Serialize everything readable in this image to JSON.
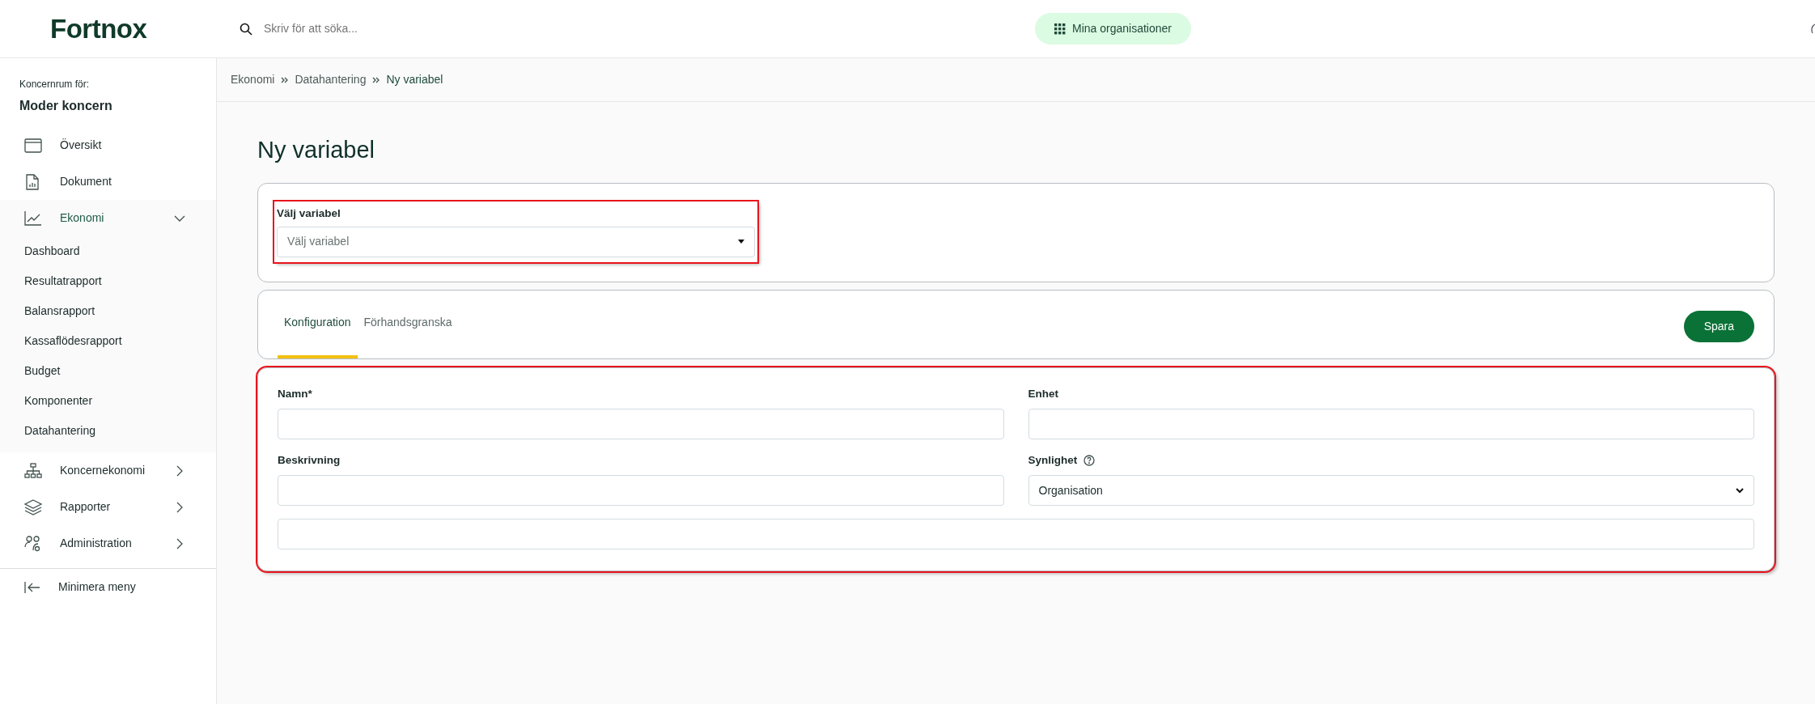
{
  "header": {
    "logo": "Fortnox",
    "search": {
      "placeholder": "Skriv för att söka..."
    },
    "org_button": "Mina organisationer"
  },
  "sidebar": {
    "caption": "Koncernrum för:",
    "org": "Moder koncern",
    "items": [
      {
        "label": "Översikt",
        "kind": "link"
      },
      {
        "label": "Dokument",
        "kind": "link"
      },
      {
        "label": "Ekonomi",
        "kind": "group",
        "expanded": true,
        "children": [
          {
            "label": "Dashboard"
          },
          {
            "label": "Resultatrapport"
          },
          {
            "label": "Balansrapport"
          },
          {
            "label": "Kassaflödesrapport"
          },
          {
            "label": "Budget"
          },
          {
            "label": "Komponenter"
          },
          {
            "label": "Datahantering"
          }
        ]
      },
      {
        "label": "Koncernekonomi",
        "kind": "group",
        "expanded": false
      },
      {
        "label": "Rapporter",
        "kind": "group",
        "expanded": false
      },
      {
        "label": "Administration",
        "kind": "group",
        "expanded": false
      }
    ],
    "minimize": "Minimera meny"
  },
  "breadcrumbs": [
    "Ekonomi",
    "Datahantering",
    "Ny variabel"
  ],
  "page_title": "Ny variabel",
  "variable_select": {
    "label": "Välj variabel",
    "placeholder": "Välj variabel",
    "highlighted": true
  },
  "tabs": [
    {
      "label": "Konfiguration",
      "selected": true
    },
    {
      "label": "Förhandsgranska",
      "selected": false
    }
  ],
  "save_button": "Spara",
  "config_form": {
    "highlighted": true,
    "fields": [
      {
        "kind": "text",
        "label": "Namn*"
      },
      {
        "kind": "text",
        "label": "Enhet"
      },
      {
        "kind": "text",
        "label": "Beskrivning"
      },
      {
        "kind": "select",
        "label": "Synlighet",
        "help": true,
        "value": "Organisation"
      },
      {
        "kind": "wide"
      }
    ]
  }
}
